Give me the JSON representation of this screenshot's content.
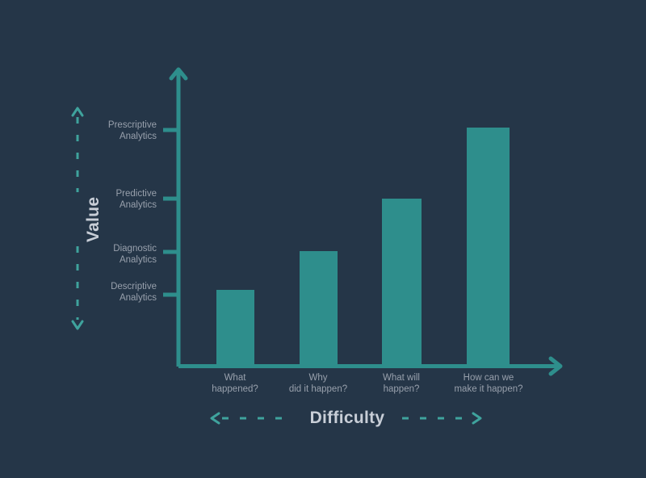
{
  "figure": {
    "background_color": "#253648",
    "accent_color": "#2e8e8c",
    "label_color": "#c8ced7",
    "tick_color": "#98a0ac"
  },
  "axis_titles": {
    "y": "Value",
    "x": "Difficulty"
  },
  "chart_data": {
    "type": "bar",
    "title": "",
    "subtitle": "",
    "xlabel": "Difficulty",
    "ylabel": "Value",
    "grid": false,
    "legend": "none",
    "orientation": "vertical",
    "bar_color": "#2e8e8c",
    "background_color": "#253648",
    "categories": [
      "What\nhappened?",
      "Why\ndid it happen?",
      "What will\nhappen?",
      "How can we\nmake it happen?"
    ],
    "category_lines": [
      [
        "What",
        "happened?"
      ],
      [
        "Why",
        "did it happen?"
      ],
      [
        "What will",
        "happen?"
      ],
      [
        "How can we",
        "make it happen?"
      ]
    ],
    "values": [
      1,
      2,
      3,
      4
    ],
    "value_tick_labels": [
      [
        "Descriptive",
        "Analytics"
      ],
      [
        "Diagnostic",
        "Analytics"
      ],
      [
        "Predictive",
        "Analytics"
      ],
      [
        "Prescriptive",
        "Analytics"
      ]
    ],
    "ytick_labels": [
      "Descriptive Analytics",
      "Diagnostic Analytics",
      "Predictive Analytics",
      "Prescriptive Analytics"
    ],
    "ylim": [
      0,
      4.4
    ],
    "xlim": [
      0,
      4.6
    ],
    "annotations": [
      "Y axis arrow points upward indicating increasing Value",
      "X axis dashed arrows point both directions around the Difficulty label"
    ]
  },
  "y_ticks": [
    {
      "line1": "Prescriptive",
      "line2": "Analytics"
    },
    {
      "line1": "Predictive",
      "line2": "Analytics"
    },
    {
      "line1": "Diagnostic",
      "line2": "Analytics"
    },
    {
      "line1": "Descriptive",
      "line2": "Analytics"
    }
  ],
  "x_ticks": [
    {
      "line1": "What",
      "line2": "happened?"
    },
    {
      "line1": "Why",
      "line2": "did it happen?"
    },
    {
      "line1": "What will",
      "line2": "happen?"
    },
    {
      "line1": "How can we",
      "line2": "make it happen?"
    }
  ]
}
